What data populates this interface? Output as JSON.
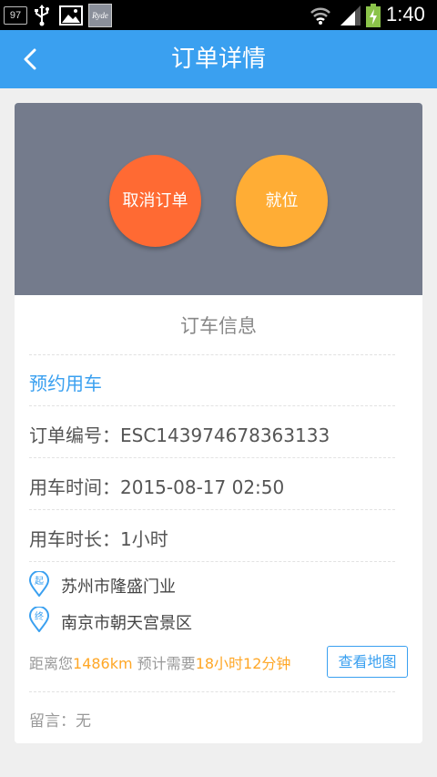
{
  "status_bar": {
    "badge": "97",
    "app_icon_text": "Ryde",
    "time": "1:40"
  },
  "header": {
    "title": "订单详情",
    "back_icon": "chevron-left-icon"
  },
  "actions": {
    "cancel_label": "取消订单",
    "ready_label": "就位"
  },
  "order_info": {
    "section_title": "订车信息",
    "booking_type": "预约用车",
    "order_number_label": "订单编号：",
    "order_number": "ESC143974678363133",
    "time_label": "用车时间：",
    "time_value": "2015-08-17 02:50",
    "duration_label": "用车时长：",
    "duration_value": "1小时",
    "start_icon_char": "起",
    "start_location": "苏州市隆盛门业",
    "end_icon_char": "终",
    "end_location": "南京市朝天宫景区",
    "distance_prefix": "距离您",
    "distance_value": "1486km",
    "eta_prefix": " 预计需要",
    "eta_value": "18小时12分钟",
    "map_button_label": "查看地图",
    "message_label": "留言：",
    "message_value": "无"
  },
  "colors": {
    "header_blue": "#3aa0f0",
    "cancel_orange": "#ff6a33",
    "ready_yellow": "#ffad35",
    "action_area_gray": "#747b8c",
    "highlight_orange": "#ffa726"
  }
}
